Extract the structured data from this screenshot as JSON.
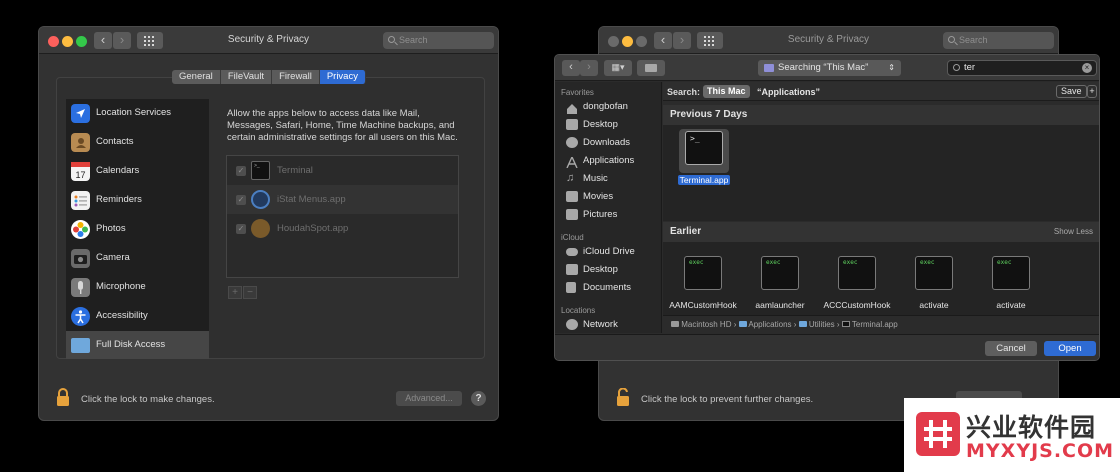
{
  "left_window": {
    "title": "Security & Privacy",
    "search_placeholder": "Search",
    "tabs": [
      {
        "label": "General",
        "active": false
      },
      {
        "label": "FileVault",
        "active": false
      },
      {
        "label": "Firewall",
        "active": false
      },
      {
        "label": "Privacy",
        "active": true
      }
    ],
    "sidebar": [
      {
        "label": "Location Services",
        "icon": "location-arrow-icon"
      },
      {
        "label": "Contacts",
        "icon": "contacts-book-icon"
      },
      {
        "label": "Calendars",
        "icon": "calendar-icon"
      },
      {
        "label": "Reminders",
        "icon": "reminders-list-icon"
      },
      {
        "label": "Photos",
        "icon": "photos-flower-icon"
      },
      {
        "label": "Camera",
        "icon": "camera-icon"
      },
      {
        "label": "Microphone",
        "icon": "microphone-icon"
      },
      {
        "label": "Accessibility",
        "icon": "accessibility-icon"
      },
      {
        "label": "Full Disk Access",
        "icon": "folder-icon",
        "selected": true
      }
    ],
    "description": "Allow the apps below to access data like Mail, Messages, Safari, Home, Time Machine backups, and certain administrative settings for all users on this Mac.",
    "apps": [
      {
        "name": "Terminal",
        "checked": true
      },
      {
        "name": "iStat Menus.app",
        "checked": true
      },
      {
        "name": "HoudahSpot.app",
        "checked": true
      }
    ],
    "add_label": "+",
    "remove_label": "−",
    "lock_text": "Click the lock to make changes.",
    "advanced_label": "Advanced...",
    "help_label": "?"
  },
  "right_window": {
    "title": "Security & Privacy",
    "search_placeholder": "Search",
    "lock_text": "Click the lock to prevent further changes."
  },
  "open_dialog": {
    "location_label": "Searching “This Mac”",
    "search_value": "ter",
    "favorites_header": "Favorites",
    "favorites": [
      {
        "label": "dongbofan",
        "icon": "home-icon"
      },
      {
        "label": "Desktop",
        "icon": "desktop-icon"
      },
      {
        "label": "Downloads",
        "icon": "downloads-icon"
      },
      {
        "label": "Applications",
        "icon": "applications-icon"
      },
      {
        "label": "Music",
        "icon": "music-icon"
      },
      {
        "label": "Movies",
        "icon": "movies-icon"
      },
      {
        "label": "Pictures",
        "icon": "pictures-icon"
      }
    ],
    "icloud_header": "iCloud",
    "icloud": [
      {
        "label": "iCloud Drive",
        "icon": "cloud-icon"
      },
      {
        "label": "Desktop",
        "icon": "desktop-icon"
      },
      {
        "label": "Documents",
        "icon": "documents-icon"
      }
    ],
    "locations_header": "Locations",
    "locations": [
      {
        "label": "Network",
        "icon": "network-globe-icon"
      }
    ],
    "scope_label": "Search:",
    "scope_this_mac": "This Mac",
    "scope_applications": "“Applications”",
    "save_label": "Save",
    "plus_label": "+",
    "section_recent": "Previous 7 Days",
    "recent_files": [
      {
        "name": "Terminal.app",
        "icon_text": ">_",
        "selected": true
      }
    ],
    "section_earlier": "Earlier",
    "show_less": "Show Less",
    "earlier_files": [
      {
        "name": "AAMCustomHook",
        "icon_text": "exec"
      },
      {
        "name": "aamlauncher",
        "icon_text": "exec"
      },
      {
        "name": "ACCCustomHook",
        "icon_text": "exec"
      },
      {
        "name": "activate",
        "icon_text": "exec"
      },
      {
        "name": "activate",
        "icon_text": "exec"
      }
    ],
    "path": [
      "Macintosh HD",
      "Applications",
      "Utilities",
      "Terminal.app"
    ],
    "cancel_label": "Cancel",
    "open_label": "Open"
  },
  "watermark": {
    "brand": "兴业软件园",
    "url": "MYXYJS.COM"
  },
  "colors": {
    "accent": "#2e6bd3",
    "window_bg": "#323232",
    "watermark_red": "#e23b4b"
  }
}
